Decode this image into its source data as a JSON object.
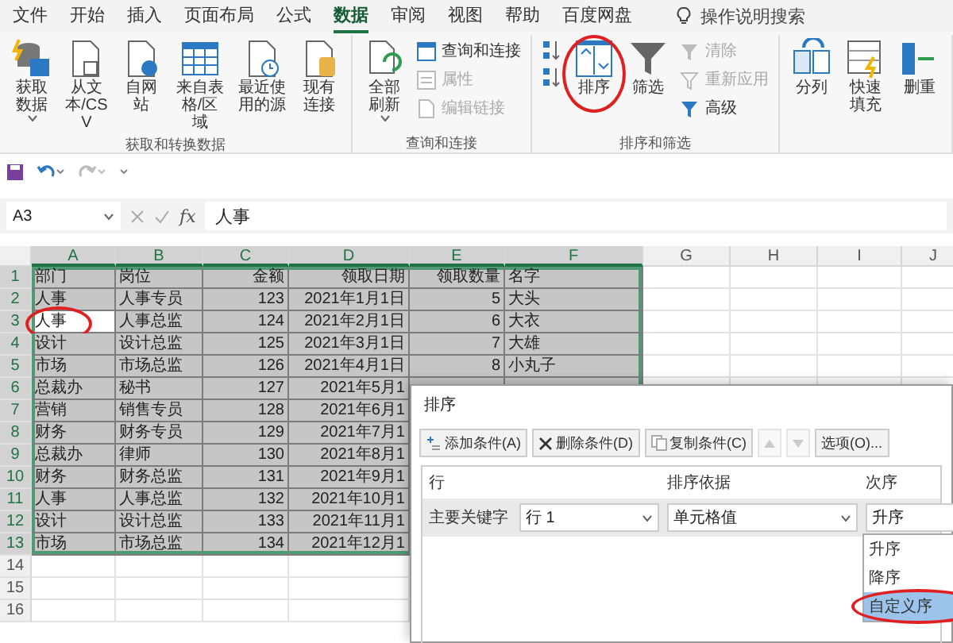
{
  "menu_tabs": [
    {
      "label": "文件",
      "selected": false
    },
    {
      "label": "开始",
      "selected": false
    },
    {
      "label": "插入",
      "selected": false
    },
    {
      "label": "页面布局",
      "selected": false
    },
    {
      "label": "公式",
      "selected": false
    },
    {
      "label": "数据",
      "selected": true
    },
    {
      "label": "审阅",
      "selected": false
    },
    {
      "label": "视图",
      "selected": false
    },
    {
      "label": "帮助",
      "selected": false
    },
    {
      "label": "百度网盘",
      "selected": false
    }
  ],
  "tell_me": {
    "label": "操作说明搜索"
  },
  "ribbon_groups": [
    {
      "label": "获取和转换数据",
      "commands": [
        {
          "kind": "large",
          "label": "获取数据",
          "dropdown": true,
          "disabled": false,
          "circled": false
        },
        {
          "kind": "large",
          "label": "从文本/CSV",
          "dropdown": false,
          "disabled": false,
          "circled": false
        },
        {
          "kind": "large",
          "label": "自网站",
          "dropdown": false,
          "disabled": false,
          "circled": false
        },
        {
          "kind": "large",
          "label": "来自表格/区域",
          "dropdown": false,
          "disabled": false,
          "circled": false
        },
        {
          "kind": "large",
          "label": "最近使用的源",
          "dropdown": false,
          "disabled": false,
          "circled": false
        },
        {
          "kind": "large",
          "label": "现有连接",
          "dropdown": false,
          "disabled": false,
          "circled": false
        }
      ]
    },
    {
      "label": "查询和连接",
      "commands": [
        {
          "kind": "large",
          "label": "全部刷新",
          "dropdown": true,
          "disabled": false,
          "circled": false
        },
        {
          "kind": "small",
          "label": "查询和连接",
          "dropdown": false,
          "disabled": false,
          "circled": false
        },
        {
          "kind": "small",
          "label": "属性",
          "dropdown": false,
          "disabled": true,
          "circled": false
        },
        {
          "kind": "small",
          "label": "编辑链接",
          "dropdown": false,
          "disabled": true,
          "circled": false
        }
      ]
    },
    {
      "label": "排序和筛选",
      "commands": [
        {
          "kind": "icon",
          "dropdown": false,
          "disabled": false,
          "circled": false
        },
        {
          "kind": "icon",
          "dropdown": false,
          "disabled": false,
          "circled": false
        },
        {
          "kind": "large",
          "label": "排序",
          "dropdown": false,
          "disabled": false,
          "circled": true
        },
        {
          "kind": "large",
          "label": "筛选",
          "dropdown": false,
          "disabled": false,
          "circled": false
        },
        {
          "kind": "small",
          "label": "清除",
          "dropdown": false,
          "disabled": true,
          "circled": false
        },
        {
          "kind": "small",
          "label": "重新应用",
          "dropdown": false,
          "disabled": true,
          "circled": false
        },
        {
          "kind": "small",
          "label": "高级",
          "dropdown": false,
          "disabled": false,
          "circled": false
        }
      ]
    },
    {
      "commands": [
        {
          "kind": "large",
          "label": "分列",
          "dropdown": false,
          "disabled": false,
          "circled": false
        },
        {
          "kind": "large",
          "label": "快速填充",
          "dropdown": false,
          "disabled": false,
          "circled": false
        },
        {
          "kind": "large",
          "label": "删重",
          "dropdown": false,
          "disabled": false,
          "circled": false
        }
      ]
    }
  ],
  "formula_bar": {
    "name_box": "A3",
    "fx": "fx",
    "value": "人事"
  },
  "grid": {
    "columns": [
      {
        "label": "A",
        "kind": "text",
        "selected": true
      },
      {
        "label": "B",
        "kind": "text",
        "selected": true
      },
      {
        "label": "C",
        "kind": "number",
        "selected": true
      },
      {
        "label": "D",
        "kind": "number",
        "selected": true
      },
      {
        "label": "E",
        "kind": "number",
        "selected": true
      },
      {
        "label": "F",
        "kind": "text",
        "selected": true
      },
      {
        "label": "G",
        "kind": "text",
        "selected": false
      },
      {
        "label": "H",
        "kind": "text",
        "selected": false
      },
      {
        "label": "I",
        "kind": "text",
        "selected": false
      },
      {
        "label": "J",
        "kind": "text",
        "selected": false
      }
    ],
    "rows": [
      {
        "number": "1",
        "selected": true,
        "circled": false,
        "cells": [
          "部门",
          "岗位",
          "金额",
          "领取日期",
          "领取数量",
          "名字"
        ]
      },
      {
        "number": "2",
        "selected": true,
        "circled": false,
        "cells": [
          "人事",
          "人事专员",
          "123",
          "2021年1月1日",
          "5",
          "大头"
        ]
      },
      {
        "number": "3",
        "selected": true,
        "circled": true,
        "cells": [
          "人事",
          "人事总监",
          "124",
          "2021年2月1日",
          "6",
          "大衣"
        ]
      },
      {
        "number": "4",
        "selected": true,
        "circled": false,
        "cells": [
          "设计",
          "设计总监",
          "125",
          "2021年3月1日",
          "7",
          "大雄"
        ]
      },
      {
        "number": "5",
        "selected": true,
        "circled": false,
        "cells": [
          "市场",
          "市场总监",
          "126",
          "2021年4月1日",
          "8",
          "小丸子"
        ]
      },
      {
        "number": "6",
        "selected": true,
        "circled": false,
        "cells": [
          "总裁办",
          "秘书",
          "127",
          "2021年5月1"
        ]
      },
      {
        "number": "7",
        "selected": true,
        "circled": false,
        "cells": [
          "营销",
          "销售专员",
          "128",
          "2021年6月1"
        ]
      },
      {
        "number": "8",
        "selected": true,
        "circled": false,
        "cells": [
          "财务",
          "财务专员",
          "129",
          "2021年7月1"
        ]
      },
      {
        "number": "9",
        "selected": true,
        "circled": false,
        "cells": [
          "总裁办",
          "律师",
          "130",
          "2021年8月1"
        ]
      },
      {
        "number": "10",
        "selected": true,
        "circled": false,
        "cells": [
          "财务",
          "财务总监",
          "131",
          "2021年9月1"
        ]
      },
      {
        "number": "11",
        "selected": true,
        "circled": false,
        "cells": [
          "人事",
          "人事总监",
          "132",
          "2021年10月1"
        ]
      },
      {
        "number": "12",
        "selected": true,
        "circled": false,
        "cells": [
          "设计",
          "设计总监",
          "133",
          "2021年11月1"
        ]
      },
      {
        "number": "13",
        "selected": true,
        "circled": false,
        "cells": [
          "市场",
          "市场总监",
          "134",
          "2021年12月1"
        ]
      },
      {
        "number": "14",
        "selected": false,
        "circled": false
      },
      {
        "number": "15",
        "selected": false,
        "circled": false
      },
      {
        "number": "16",
        "selected": false,
        "circled": false
      }
    ]
  },
  "sort_dialog": {
    "title": "排序",
    "toolbar": [
      {
        "kind": "add",
        "label": "添加条件(A)",
        "disabled": false
      },
      {
        "kind": "delete",
        "label": "删除条件(D)",
        "disabled": false
      },
      {
        "kind": "copy",
        "label": "复制条件(C)",
        "disabled": false
      },
      {
        "kind": "up",
        "disabled": true
      },
      {
        "kind": "down",
        "disabled": true
      },
      {
        "kind": "options",
        "label": "选项(O)...",
        "disabled": false
      }
    ],
    "headers": [
      "行",
      "排序依据",
      "次序"
    ],
    "condition": {
      "label": "主要关键字",
      "key": "行 1",
      "sort_on": "单元格值",
      "order": "升序"
    },
    "order_options": [
      {
        "label": "升序",
        "selected": false,
        "circled": false
      },
      {
        "label": "降序",
        "selected": false,
        "circled": false
      },
      {
        "label": "自定义序",
        "selected": true,
        "circled": true
      }
    ]
  }
}
